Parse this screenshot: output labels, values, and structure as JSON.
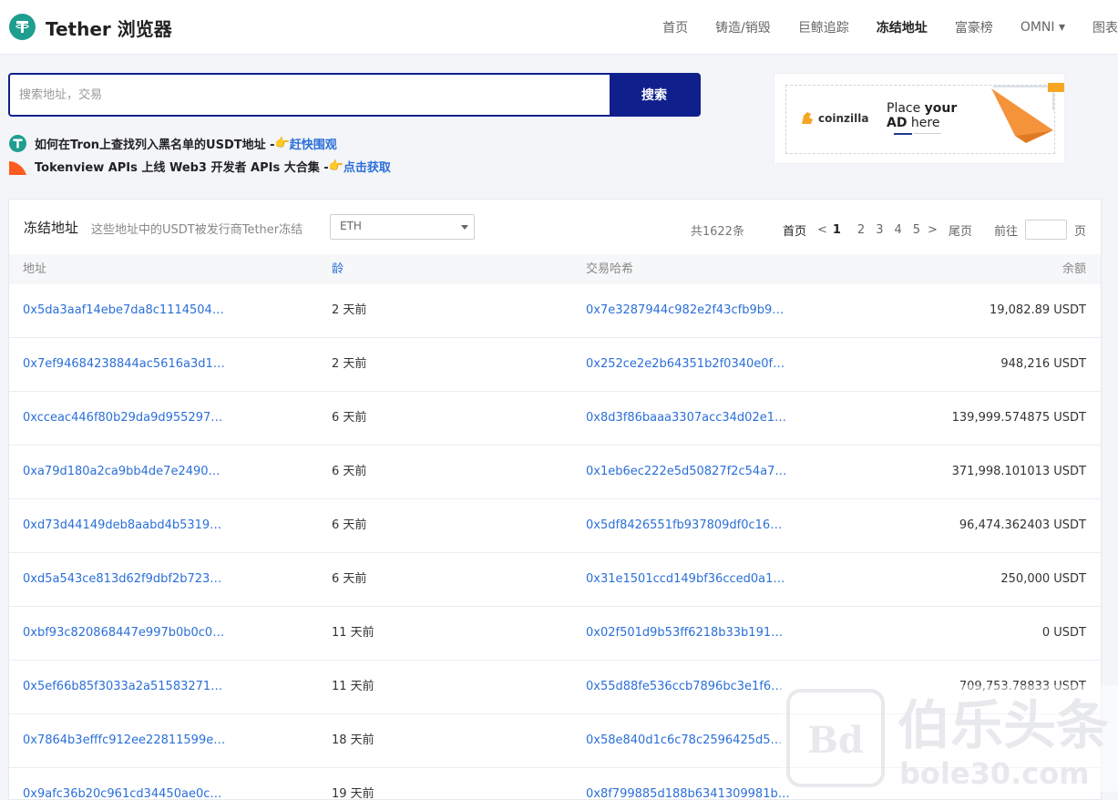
{
  "header": {
    "brand": "Tether 浏览器",
    "nav": [
      {
        "label": "首页",
        "active": false
      },
      {
        "label": "铸造/销毁",
        "active": false
      },
      {
        "label": "巨鲸追踪",
        "active": false
      },
      {
        "label": "冻结地址",
        "active": true
      },
      {
        "label": "富豪榜",
        "active": false
      },
      {
        "label": "OMNI ▾",
        "active": false
      },
      {
        "label": "图表",
        "active": false
      }
    ]
  },
  "search": {
    "placeholder": "搜索地址，交易",
    "button": "搜索"
  },
  "notices": [
    {
      "text": "如何在Tron上查找列入黑名单的USDT地址 - ",
      "emoji": "👉",
      "link": "赶快围观",
      "icon": "tether-icon"
    },
    {
      "text": "Tokenview APIs 上线 Web3 开发者 APIs 大合集 - ",
      "emoji": "👉",
      "link": "点击获取",
      "icon": "tokenview-icon"
    }
  ],
  "ad": {
    "brand": "coinzilla",
    "line1a": "Place ",
    "line1b": "your",
    "line2a": "AD",
    "line2b": " here"
  },
  "card": {
    "title": "冻结地址",
    "subtitle": "这些地址中的USDT被发行商Tether冻结",
    "chain_selected": "ETH",
    "pager": {
      "total": "共1622条",
      "first": "首页",
      "prev": "<",
      "pages": [
        "1",
        "2",
        "3",
        "4",
        "5"
      ],
      "current": "1",
      "next": ">",
      "last": "尾页",
      "goto_label": "前往",
      "goto_suffix": "页"
    },
    "columns": [
      "地址",
      "龄",
      "交易哈希",
      "余额"
    ],
    "rows": [
      {
        "address": "0x5da3aaf14ebe7da8c1114504…",
        "age": "2 天前",
        "hash": "0x7e3287944c982e2f43cfb9b9…",
        "balance": "19,082.89 USDT"
      },
      {
        "address": "0x7ef94684238844ac5616a3d1…",
        "age": "2 天前",
        "hash": "0x252ce2e2b64351b2f0340e0f…",
        "balance": "948,216 USDT"
      },
      {
        "address": "0xcceac446f80b29da9d955297…",
        "age": "6 天前",
        "hash": "0x8d3f86baaa3307acc34d02e1…",
        "balance": "139,999.574875 USDT"
      },
      {
        "address": "0xa79d180a2ca9bb4de7e2490…",
        "age": "6 天前",
        "hash": "0x1eb6ec222e5d50827f2c54a7…",
        "balance": "371,998.101013 USDT"
      },
      {
        "address": "0xd73d44149deb8aabd4b5319…",
        "age": "6 天前",
        "hash": "0x5df8426551fb937809df0c16…",
        "balance": "96,474.362403 USDT"
      },
      {
        "address": "0xd5a543ce813d62f9dbf2b723…",
        "age": "6 天前",
        "hash": "0x31e1501ccd149bf36cced0a1…",
        "balance": "250,000 USDT"
      },
      {
        "address": "0xbf93c820868447e997b0b0c0…",
        "age": "11 天前",
        "hash": "0x02f501d9b53ff6218b33b191…",
        "balance": "0 USDT"
      },
      {
        "address": "0x5ef66b85f3033a2a51583271…",
        "age": "11 天前",
        "hash": "0x55d88fe536ccb7896bc3e1f6…",
        "balance": "709,753.78833 USDT"
      },
      {
        "address": "0x7864b3efffc912ee22811599e…",
        "age": "18 天前",
        "hash": "0x58e840d1c6c78c2596425d5…",
        "balance": ""
      },
      {
        "address": "0x9afc36b20c961cd34450ae0c…",
        "age": "19 天前",
        "hash": "0x8f799885d188b6341309981b…",
        "balance": ""
      }
    ]
  },
  "watermark": {
    "cn": "伯乐头条",
    "en": "bole30.com"
  }
}
